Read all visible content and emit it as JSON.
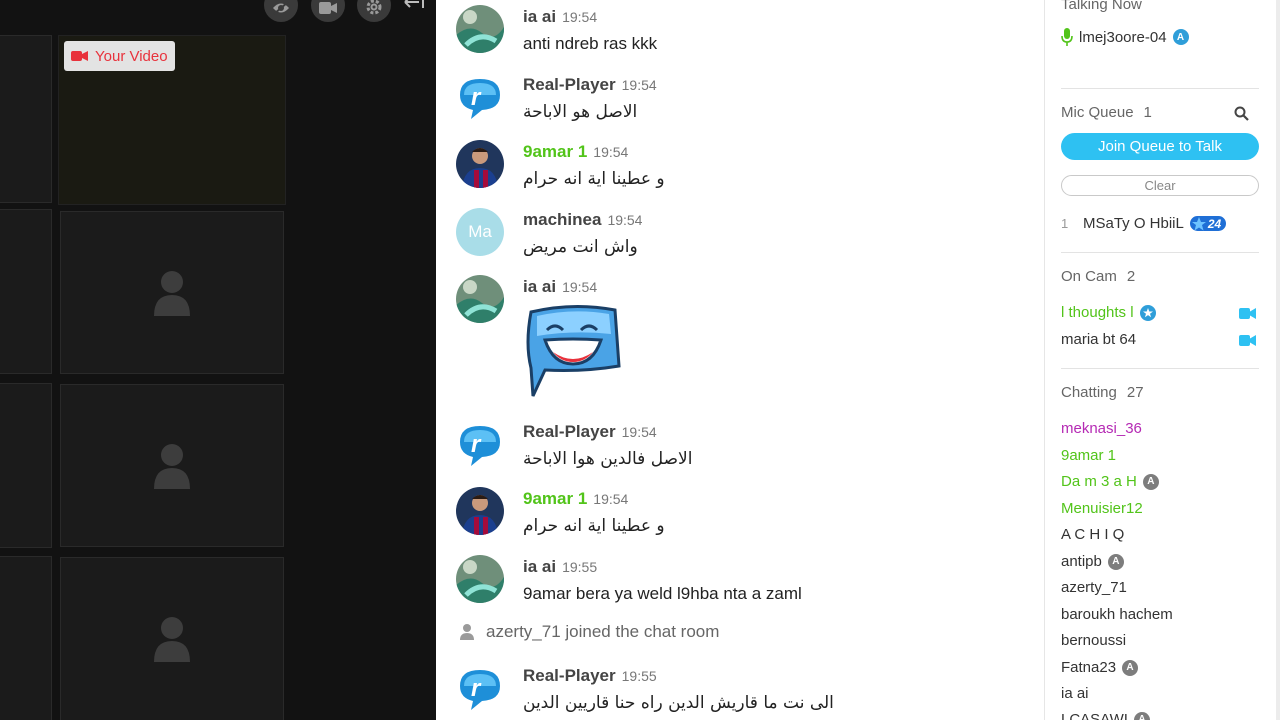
{
  "video": {
    "your_video_label": "Your Video"
  },
  "chat": {
    "messages": [
      {
        "user": "ia ai",
        "time": "19:54",
        "text": "anti ndreb ras kkk",
        "avatar": "landscape-avatar"
      },
      {
        "user": "Real-Player",
        "time": "19:54",
        "text": "الاصل هو الاباحة",
        "avatar": "realplayer-logo"
      },
      {
        "user": "9amar 1",
        "time": "19:54",
        "text": "و عطينا اية انه حرام",
        "avatar": "football-player-avatar"
      },
      {
        "user": "machinea",
        "time": "19:54",
        "text": "واش انت مريض",
        "avatar": "initials-avatar",
        "initials": "Ma"
      },
      {
        "user": "ia ai",
        "time": "19:54",
        "text": "",
        "avatar": "landscape-avatar",
        "sticker": "laughing-speech-bubble-sticker"
      },
      {
        "user": "Real-Player",
        "time": "19:54",
        "text": "الاصل فالدين هوا الاباحة",
        "avatar": "realplayer-logo"
      },
      {
        "user": "9amar 1",
        "time": "19:54",
        "text": "و عطينا اية انه حرام",
        "avatar": "football-player-avatar"
      },
      {
        "user": "ia ai",
        "time": "19:55",
        "text": "9amar bera ya weld l9hba nta a zaml",
        "avatar": "landscape-avatar"
      },
      {
        "user": "Real-Player",
        "time": "19:55",
        "text": "الى نت ما قاريش  الدين راه حنا قاريين الدين",
        "avatar": "realplayer-logo"
      }
    ],
    "join_notice": "azerty_71 joined the chat room"
  },
  "users": {
    "talking_now": {
      "title": "Talking Now",
      "user": "lmej3oore-04"
    },
    "mic_queue": {
      "title": "Mic Queue",
      "count": "1",
      "join_button": "Join Queue to Talk",
      "clear_button": "Clear",
      "entries": [
        {
          "position": "1",
          "name": "MSaTy O HbiiL",
          "badge": "24"
        }
      ]
    },
    "on_cam": {
      "title": "On Cam",
      "count": "2",
      "entries": [
        {
          "name": "l thoughts l",
          "color": "#52c41a"
        },
        {
          "name": "maria bt 64",
          "color": "#333333"
        }
      ]
    },
    "chatting": {
      "title": "Chatting",
      "count": "27",
      "entries": [
        {
          "name": "meknasi_36",
          "color": "#b52ab4"
        },
        {
          "name": "9amar 1",
          "color": "#52c41a"
        },
        {
          "name": "Da m 3 a H",
          "color": "#52c41a",
          "badge": "A"
        },
        {
          "name": "Menuisier12",
          "color": "#52c41a"
        },
        {
          "name": "A C H I Q",
          "color": "#333333"
        },
        {
          "name": "antipb",
          "color": "#333333",
          "badge": "A"
        },
        {
          "name": "azerty_71",
          "color": "#333333"
        },
        {
          "name": "baroukh hachem",
          "color": "#333333"
        },
        {
          "name": "bernoussi",
          "color": "#333333"
        },
        {
          "name": "Fatna23",
          "color": "#333333",
          "badge": "A"
        },
        {
          "name": "ia ai",
          "color": "#333333"
        },
        {
          "name": "LCASAWI",
          "color": "#333333",
          "badge": "A"
        }
      ]
    }
  },
  "colors": {
    "accent": "#2ec1f2",
    "green_user": "#52c41a",
    "purple_user": "#b52ab4",
    "badge_blue": "#1f6fd6",
    "red_cam": "#e8323c"
  }
}
